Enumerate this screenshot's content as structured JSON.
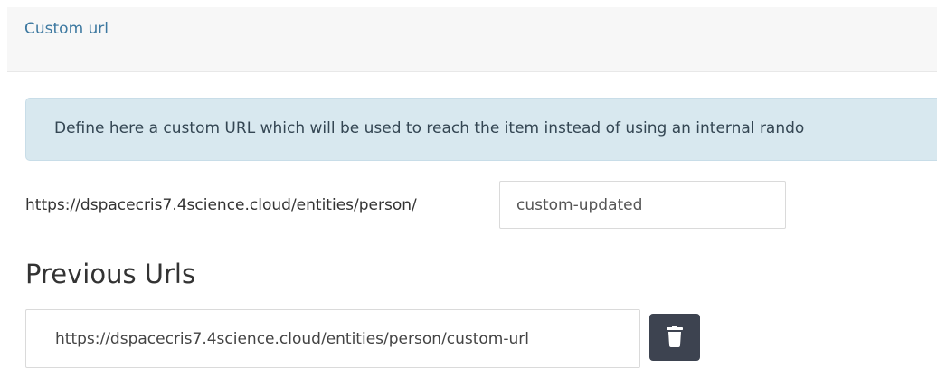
{
  "header": {
    "link_label": "Custom url"
  },
  "info": {
    "text": "Define here a custom URL which will be used to reach the item instead of using an internal rando"
  },
  "custom_url": {
    "prefix": "https://dspacecris7.4science.cloud/entities/person/",
    "value": "custom-updated"
  },
  "previous_urls": {
    "title": "Previous Urls",
    "items": [
      {
        "value": "https://dspacecris7.4science.cloud/entities/person/custom-url",
        "delete_icon": "trash-icon"
      }
    ]
  },
  "colors": {
    "link": "#3c78a0",
    "alert_background": "#d8e8ef",
    "delete_button": "#3d4350"
  }
}
